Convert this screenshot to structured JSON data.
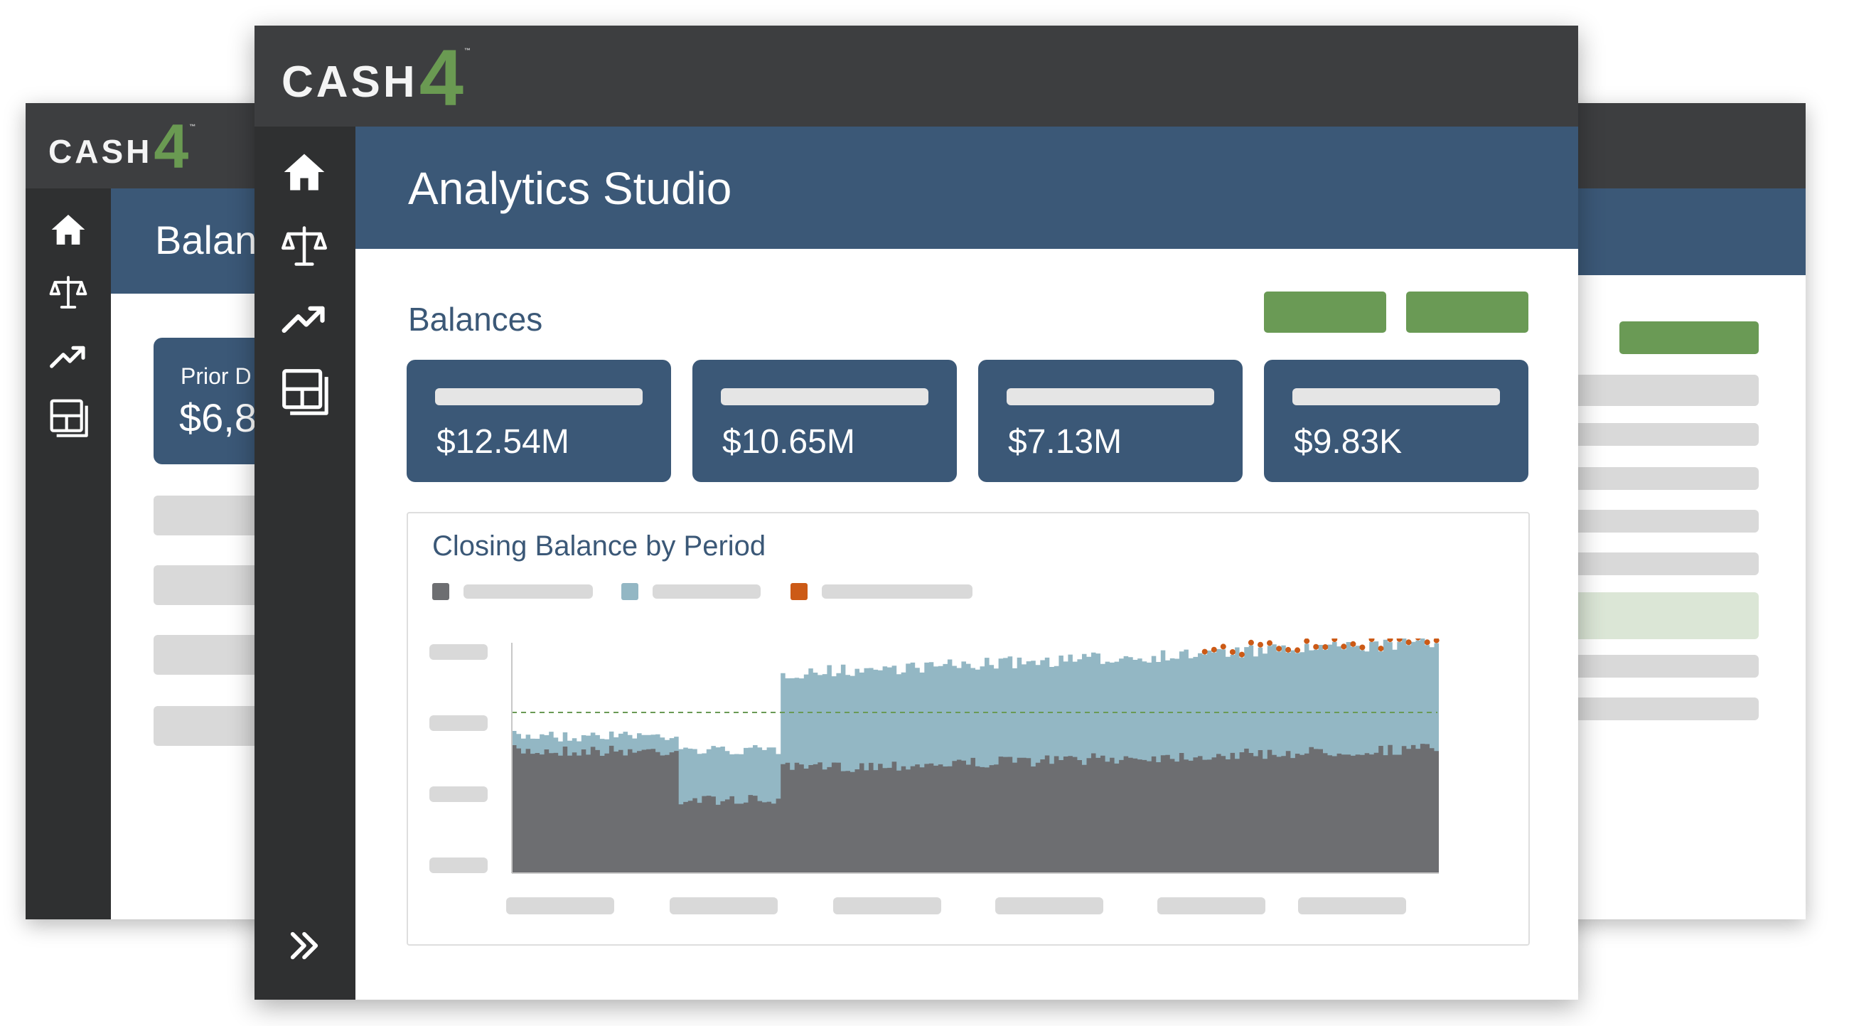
{
  "app": {
    "logo_text": "CASH",
    "logo_number": "4",
    "logo_tm": "™"
  },
  "back_window": {
    "page_title": "Balan",
    "card_label": "Prior D",
    "card_value": "$6,8"
  },
  "front_window": {
    "page_title": "Analytics Studio",
    "section_title": "Balances",
    "kpis": [
      {
        "value": "$12.54M"
      },
      {
        "value": "$10.65M"
      },
      {
        "value": "$7.13M"
      },
      {
        "value": "$9.83K"
      }
    ]
  },
  "chart_data": {
    "type": "area",
    "title": "Closing Balance by Period",
    "legend_placement": "top-left",
    "series": [
      {
        "color": "#6d6e71"
      },
      {
        "color": "#93b7c4"
      },
      {
        "color": "#cc5a16"
      }
    ],
    "reference_line": {
      "style": "dashed",
      "color": "#6a9a55"
    },
    "grid": false
  },
  "colors": {
    "titlebar": "#3d3e40",
    "sidebar": "#2f3031",
    "header": "#3b5877",
    "accent_green": "#6a9a55",
    "series_gray": "#6d6e71",
    "series_blue": "#93b7c4",
    "series_orange": "#cc5a16"
  },
  "icons": [
    "home-icon",
    "scales-icon",
    "trend-up-icon",
    "dashboard-icon",
    "chevrons-right-icon"
  ]
}
